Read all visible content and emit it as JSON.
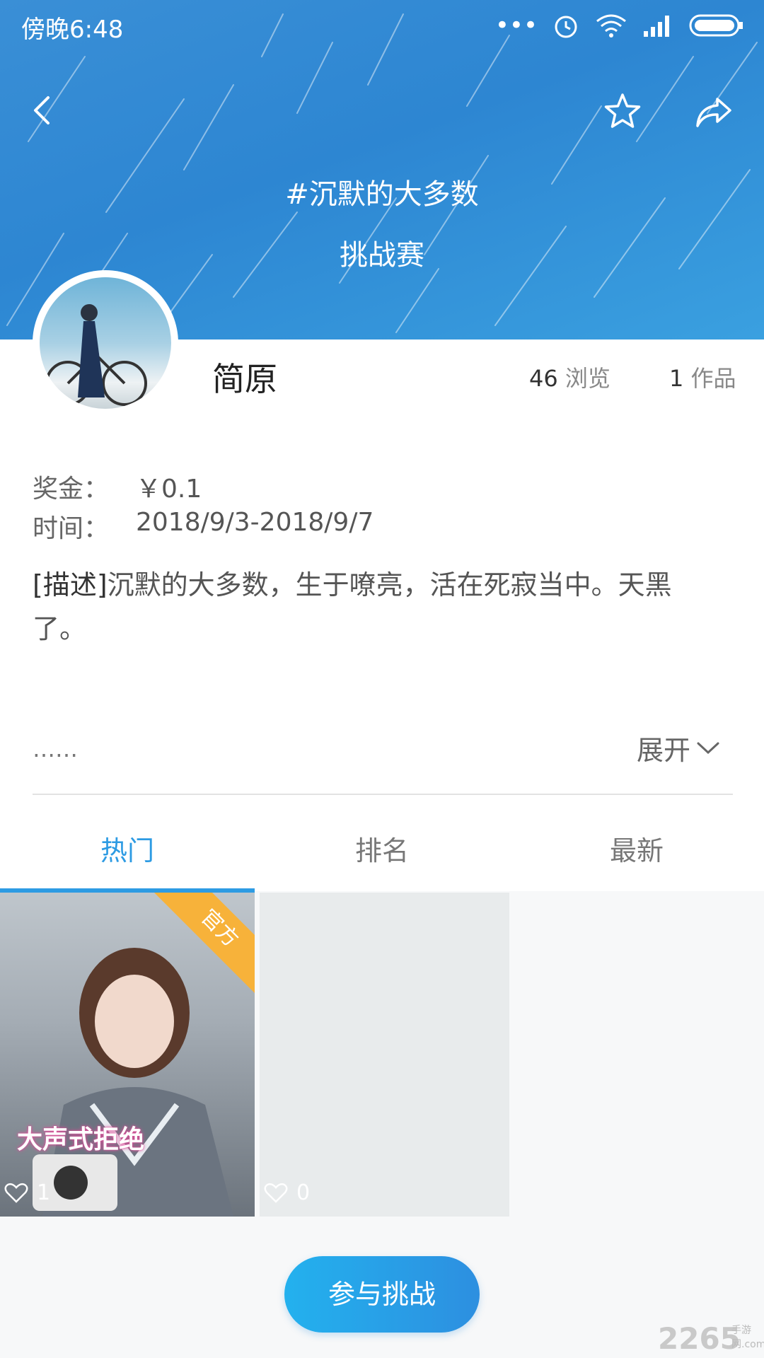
{
  "status_bar": {
    "time": "傍晚6:48"
  },
  "header": {
    "hashtag": "#沉默的大多数",
    "subtitle": "挑战赛",
    "accent": "#2d86d2"
  },
  "creator": {
    "name": "简原"
  },
  "stats": {
    "views_count": "46",
    "views_label": "浏览",
    "works_count": "1",
    "works_label": "作品"
  },
  "details": {
    "reward_label": "奖金：",
    "reward_value": "￥0.1",
    "period_label": "时间：",
    "period_value": "2018/9/3-2018/9/7",
    "desc_tag": "[描述]",
    "desc_text": "沉默的大多数，生于嘹亮，活在死寂当中。天黑了。",
    "ellipsis": "……",
    "expand_label": "展开"
  },
  "tabs": [
    {
      "label": "热门",
      "active": true
    },
    {
      "label": "排名",
      "active": false
    },
    {
      "label": "最新",
      "active": false
    }
  ],
  "entries": [
    {
      "badge": "官方",
      "overlay": "大声式拒绝",
      "likes": "1"
    },
    {
      "likes": "0"
    }
  ],
  "cta": {
    "label": "参与挑战"
  },
  "watermark": {
    "text": "2265",
    "sub": "手游网.com"
  }
}
